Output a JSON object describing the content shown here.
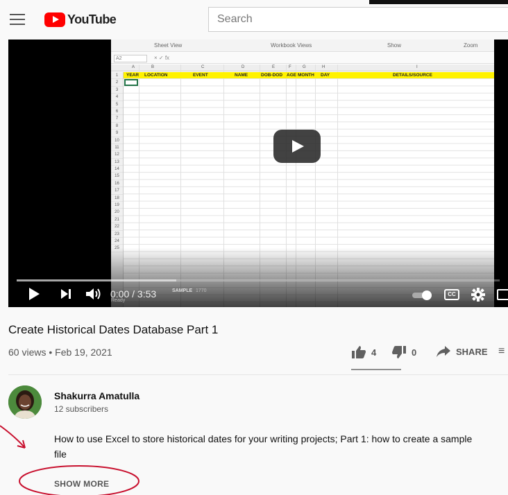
{
  "header": {
    "logo_text": "YouTube",
    "search_placeholder": "Search"
  },
  "video": {
    "time": "0:00 / 3:53",
    "cc_label": "CC",
    "spreadsheet": {
      "ribbon": [
        "Sheet View",
        "Workbook Views",
        "Show",
        "Zoom"
      ],
      "namebox": "A2",
      "columns": [
        "A",
        "B",
        "C",
        "D",
        "E",
        "F",
        "G",
        "H",
        "I"
      ],
      "headers": [
        "YEAR",
        "LOCATION",
        "EVENT",
        "NAME",
        "DOB-DOD",
        "AGE",
        "MONTH",
        "DAY",
        "DETAILS/SOURCE"
      ],
      "rows": [
        "1",
        "2",
        "3",
        "4",
        "5",
        "6",
        "7",
        "8",
        "9",
        "10",
        "11",
        "12",
        "13",
        "14",
        "15",
        "16",
        "17",
        "18",
        "19",
        "20",
        "21",
        "22",
        "23",
        "24",
        "25"
      ],
      "sheet_tab": "SAMPLE",
      "status_left": "Ready",
      "status_mid": "1770"
    }
  },
  "info": {
    "title": "Create Historical Dates Database Part 1",
    "meta": "60 views • Feb 19, 2021",
    "likes": "4",
    "dislikes": "0",
    "share_label": "SHARE"
  },
  "channel": {
    "name": "Shakurra Amatulla",
    "subscribers": "12 subscribers"
  },
  "description": "How to use Excel to store historical dates for your writing projects; Part 1: how to create a sample file",
  "show_more_label": "SHOW MORE",
  "colors": {
    "brand_red": "#ff0000",
    "annotation_red": "#c8102e",
    "excel_header": "#fff200"
  }
}
